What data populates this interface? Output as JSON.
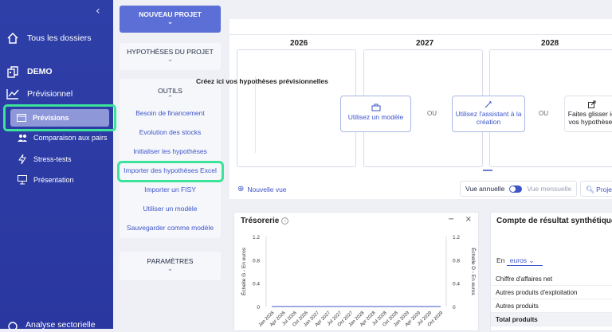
{
  "sidebar": {
    "all_folders": "Tous les dossiers",
    "project": "DEMO",
    "section": "Prévisionnel",
    "items": [
      {
        "label": "Prévisions",
        "active": true
      },
      {
        "label": "Comparaison aux pairs"
      },
      {
        "label": "Stress-tests"
      },
      {
        "label": "Présentation"
      }
    ],
    "bottom": "Analyse sectorielle",
    "collapse_glyph": "‹"
  },
  "menu": {
    "new_project": "NOUVEAU PROJET",
    "hypotheses": "HYPOTHÈSES DU PROJET",
    "tools_title": "OUTILS",
    "tools": [
      "Besoin de financement",
      "Evolution des stocks",
      "Initialiser les hypothèses",
      "Importer des hypothèses Excel",
      "Importer un FISY",
      "Utiliser un modèle",
      "Sauvegarder comme modèle"
    ],
    "params": "PARAMÈTRES"
  },
  "timeline": {
    "years": [
      "2026",
      "2027",
      "2028"
    ],
    "create_title": "Créez ici vos hypothèses prévisionnelles",
    "option_model": "Utilisez un modèle",
    "option_assistant": "Utilisez l'assistant à la création",
    "option_drag": "Faites glisser ici vos hypothèses",
    "ou": "OU"
  },
  "toolbar": {
    "new_view": "Nouvelle vue",
    "annual": "Vue annuelle",
    "monthly": "Vue mensuelle",
    "project": "Projeter"
  },
  "treso": {
    "title": "Trésorerie",
    "left_axis": "Échelle G - En euros",
    "right_axis": "Échelle D - En euros",
    "minimize": "−",
    "close": "×"
  },
  "chart_data": {
    "type": "line",
    "title": "Trésorerie",
    "ylabel": "Échelle G - En euros",
    "y2label": "Échelle D - En euros",
    "ylim": [
      0,
      1.2
    ],
    "yticks": [
      "1.2",
      "1",
      "0.8",
      "0.6",
      "0.4",
      "0.2",
      "0"
    ],
    "categories": [
      "Jan 2026",
      "Apr 2026",
      "Jul 2026",
      "Oct 2026",
      "Jan 2027",
      "Apr 2027",
      "Jul 2027",
      "Oct 2027",
      "Jan 2028",
      "Apr 2028",
      "Jul 2028",
      "Oct 2028",
      "Jan 2029",
      "Apr 2029",
      "Jul 2029",
      "Oct 2029"
    ],
    "series": [
      {
        "values": [
          0,
          0,
          0,
          0,
          0,
          0,
          0,
          0,
          0,
          0,
          0,
          0,
          0,
          0,
          0,
          0
        ]
      }
    ]
  },
  "cr": {
    "title": "Compte de résultat synthétique",
    "unit_prefix": "En",
    "unit": "euros",
    "rows": [
      "Chiffre d'affaires net",
      "Autres produits d'exploitation",
      "Autres produits",
      "Total produits"
    ]
  },
  "colors": {
    "sidebar": "#2f3fa8",
    "accent": "#3d55c9",
    "highlight": "#3be39b"
  }
}
